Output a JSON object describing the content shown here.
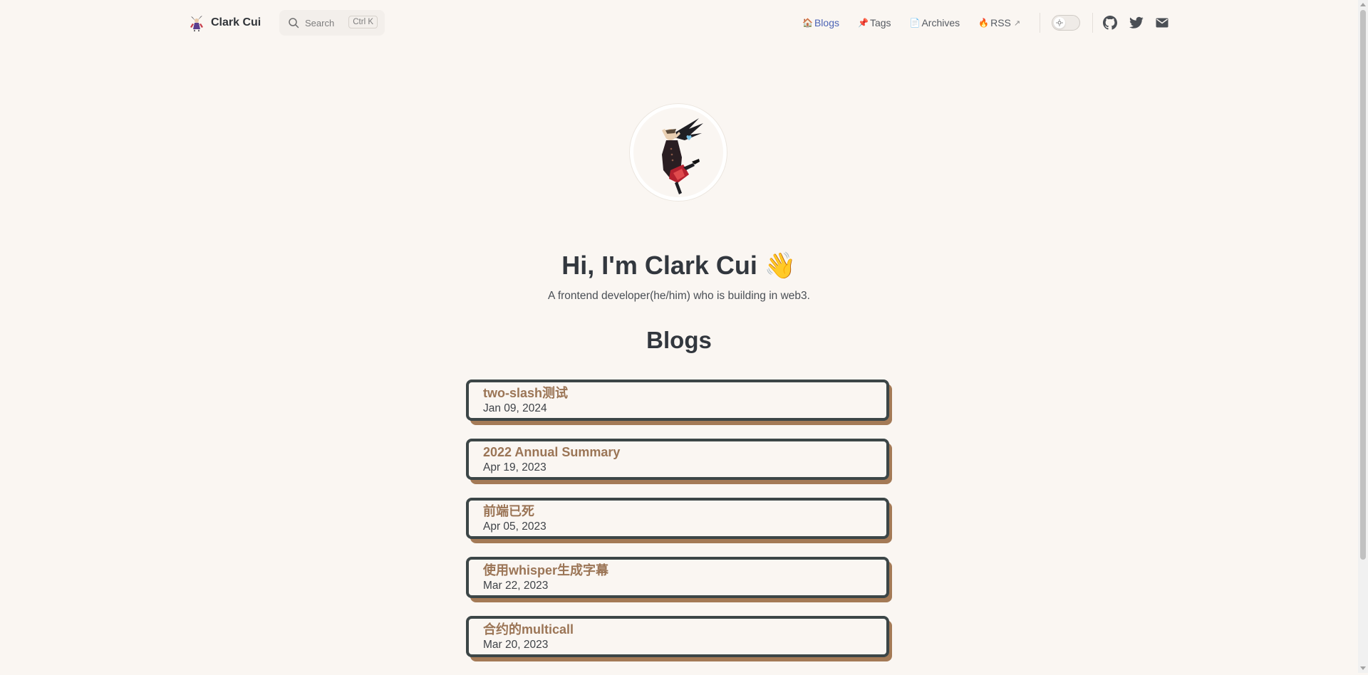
{
  "site": {
    "brand_name": "Clark Cui",
    "logo_icon": "anime-character-logo-icon"
  },
  "search": {
    "placeholder": "Search",
    "shortcut": "Ctrl K"
  },
  "nav": {
    "items": [
      {
        "label": "Blogs",
        "icon": "🏠",
        "active": true
      },
      {
        "label": "Tags",
        "icon": "📌",
        "active": false
      },
      {
        "label": "Archives",
        "icon": "📄",
        "active": false
      },
      {
        "label": "RSS",
        "icon": "🔥",
        "external_marker": "↗",
        "active": false
      }
    ]
  },
  "theme_toggle": {
    "state": "light"
  },
  "social": {
    "icons": [
      "github-icon",
      "twitter-icon",
      "mail-icon"
    ]
  },
  "hero": {
    "title": "Hi, I'm Clark Cui",
    "emoji": "👋",
    "subtitle": "A frontend developer(he/him) who is building in web3."
  },
  "blogs": {
    "heading": "Blogs",
    "items": [
      {
        "title": "two-slash测试",
        "date": "Jan 09, 2024"
      },
      {
        "title": "2022 Annual Summary",
        "date": "Apr 19, 2023"
      },
      {
        "title": "前端已死",
        "date": "Apr 05, 2023"
      },
      {
        "title": "使用whisper生成字幕",
        "date": "Mar 22, 2023"
      },
      {
        "title": "合约的multicall",
        "date": "Mar 20, 2023"
      }
    ]
  },
  "colors": {
    "background": "#faf6f2",
    "accent_link": "#4b63b5",
    "card_border": "#3c4647",
    "card_shadow": "#a47a56",
    "card_title": "#9b7556"
  }
}
